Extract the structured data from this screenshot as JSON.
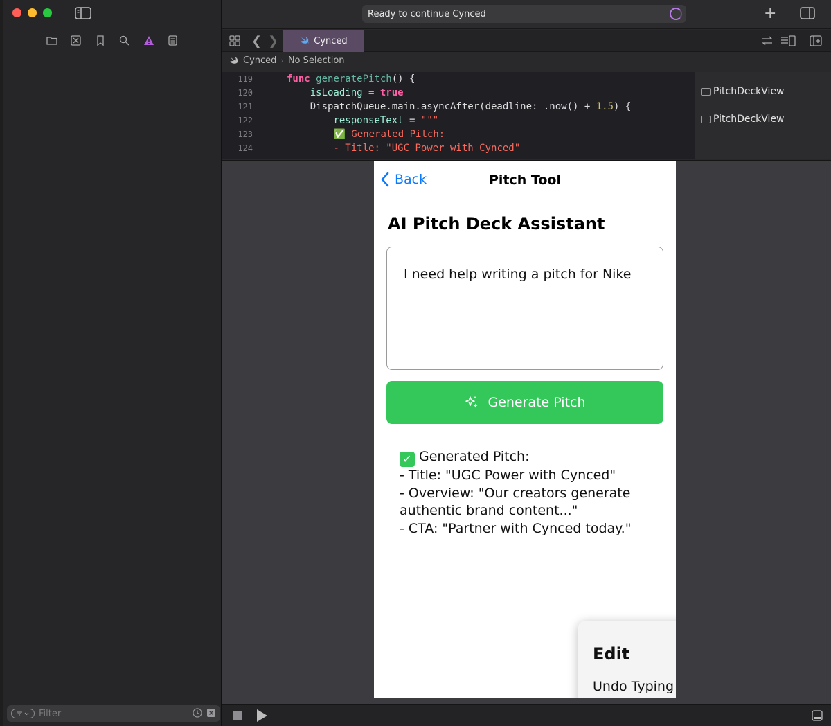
{
  "window": {
    "status_text": "Ready to continue Cynced"
  },
  "navigator": {
    "filter_placeholder": "Filter"
  },
  "editor": {
    "tab_label": "Cynced",
    "breadcrumb": [
      "Cynced",
      "No Selection"
    ],
    "code_lines": [
      {
        "number": "119",
        "parts": [
          {
            "cls": "kw",
            "text": "func "
          },
          {
            "cls": "fn",
            "text": "generatePitch"
          },
          {
            "cls": "plain",
            "text": "() {"
          }
        ]
      },
      {
        "number": "120",
        "parts": [
          {
            "cls": "plain",
            "text": "    "
          },
          {
            "cls": "id",
            "text": "isLoading"
          },
          {
            "cls": "plain",
            "text": " = "
          },
          {
            "cls": "kw",
            "text": "true"
          }
        ]
      },
      {
        "number": "121",
        "parts": [
          {
            "cls": "plain",
            "text": "    DispatchQueue.main.asyncAfter(deadline: .now() + "
          },
          {
            "cls": "num",
            "text": "1.5"
          },
          {
            "cls": "plain",
            "text": ") {"
          }
        ]
      },
      {
        "number": "122",
        "parts": [
          {
            "cls": "plain",
            "text": "        "
          },
          {
            "cls": "id",
            "text": "responseText"
          },
          {
            "cls": "plain",
            "text": " = "
          },
          {
            "cls": "str",
            "text": "\"\"\""
          }
        ]
      },
      {
        "number": "123",
        "parts": [
          {
            "cls": "plain",
            "text": "        "
          },
          {
            "cls": "str",
            "text": "✅ Generated Pitch:"
          }
        ]
      },
      {
        "number": "124",
        "parts": [
          {
            "cls": "plain",
            "text": "        "
          },
          {
            "cls": "str",
            "text": "- Title: \"UGC Power with Cynced\""
          }
        ]
      }
    ],
    "minimap_items": [
      "PitchDeckView",
      "PitchDeckView"
    ]
  },
  "app": {
    "back_label": "Back",
    "nav_title": "Pitch Tool",
    "heading": "AI Pitch Deck Assistant",
    "input_value": "I need help writing a pitch for Nike",
    "generate_label": "Generate Pitch",
    "result_heading": "Generated Pitch:",
    "result_lines": [
      "- Title: \"UGC Power with Cynced\"",
      "- Overview: \"Our creators generate authentic brand content...\"",
      "- CTA: \"Partner with Cynced today.\""
    ],
    "edit_menu": {
      "title": "Edit",
      "item": "Undo Typing"
    }
  },
  "colors": {
    "accent_blue": "#0a7aff",
    "generate_green": "#34c759",
    "tab_active": "#5a4a64"
  }
}
